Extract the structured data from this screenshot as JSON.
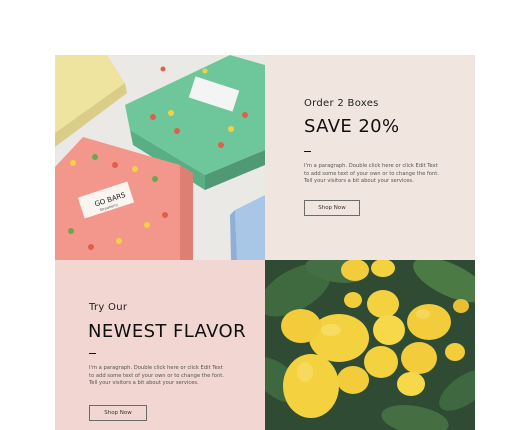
{
  "promo": {
    "kicker": "Order 2 Boxes",
    "headline": "SAVE 20%",
    "paragraph": "I'm a paragraph.  Double click here or click Edit Text to add some text of your own or to change the font. Tell your visitors a bit about your services.",
    "button_label": "Shop Now"
  },
  "flavor": {
    "kicker": "Try Our",
    "headline": "NEWEST FLAVOR",
    "paragraph": "I'm a paragraph.  Double click here or click Edit Text to add some text of your own or to change the font. Tell your visitors a bit about your services.",
    "button_label": "Shop Now"
  },
  "product_images": {
    "box_brand_text": "GO BARS",
    "box_brand_subtext": "Strawberry",
    "colors": {
      "pink_box": "#f3978c",
      "green_box": "#6ec79a",
      "yellow_box": "#f2e48a",
      "blue_box": "#a8c6e6",
      "promo_bg": "#f1e6df",
      "flavor_bg": "#f1d6d1",
      "lemon": "#f4d13f",
      "leaf": "#2f4b33"
    }
  }
}
